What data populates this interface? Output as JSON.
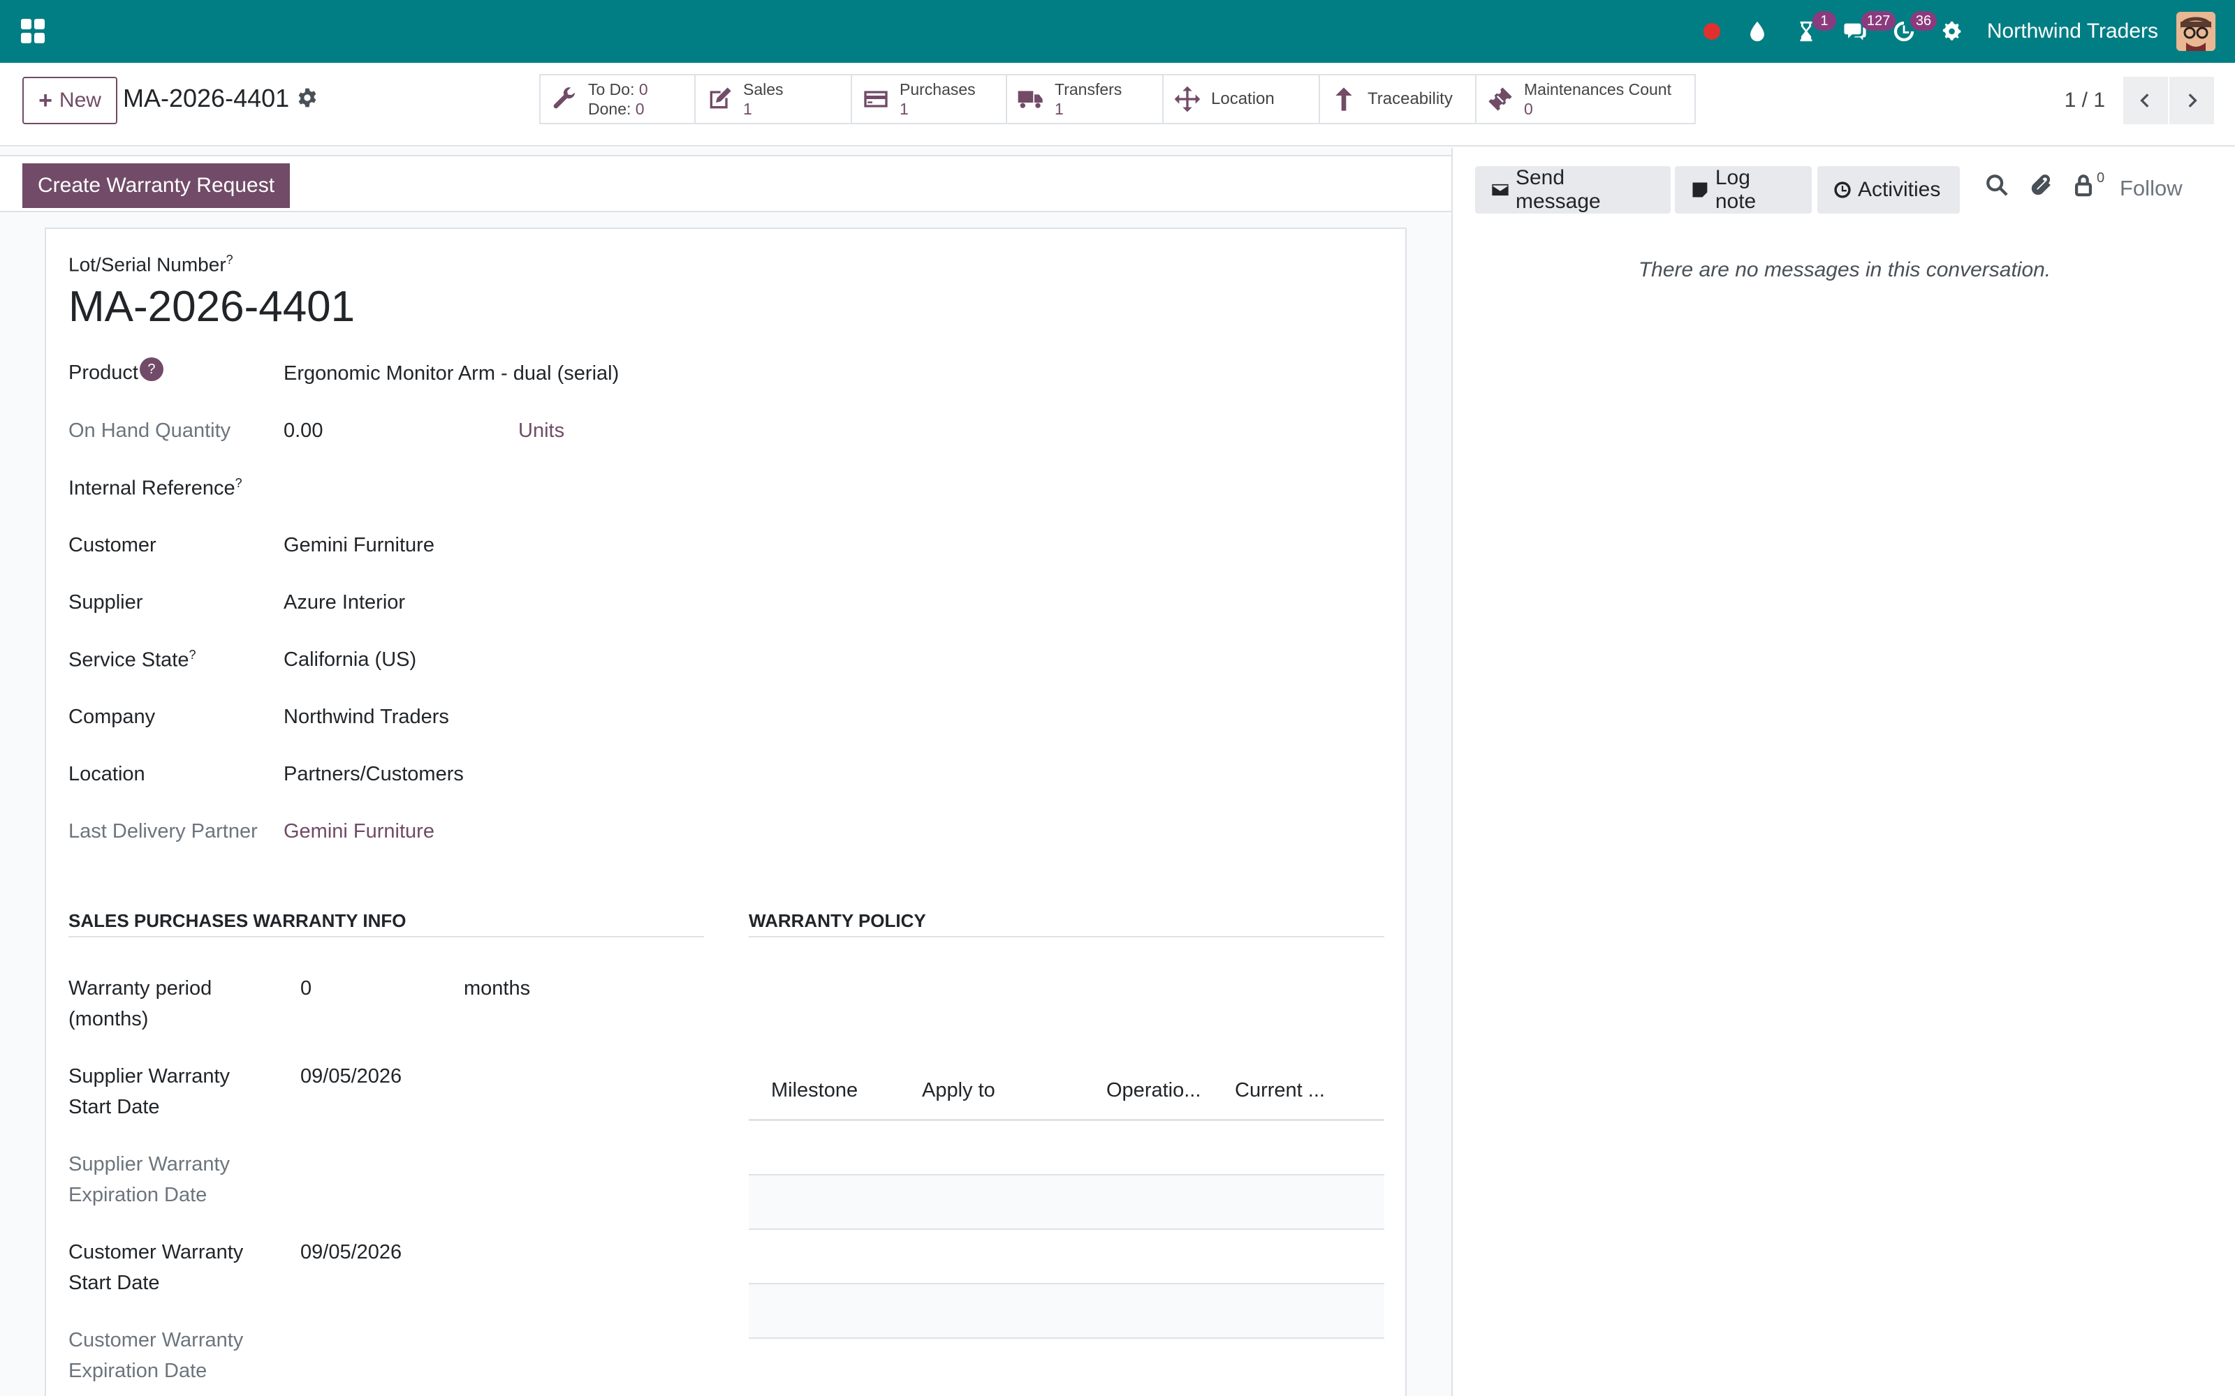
{
  "navbar": {
    "company": "Northwind Traders",
    "activity_badge": "1",
    "messages_badge": "127",
    "clock_badge": "36"
  },
  "control_panel": {
    "new_label": "New",
    "record_name": "MA-2026-4401",
    "pager_value": "1 / 1"
  },
  "smart_buttons": {
    "maintenance": {
      "todo_label": "To Do:",
      "todo_value": "0",
      "done_label": "Done:",
      "done_value": "0"
    },
    "sales": {
      "label": "Sales",
      "value": "1"
    },
    "purchases": {
      "label": "Purchases",
      "value": "1"
    },
    "transfers": {
      "label": "Transfers",
      "value": "1"
    },
    "location": {
      "label": "Location"
    },
    "traceability": {
      "label": "Traceability"
    },
    "maintenances_count": {
      "label": "Maintenances Count",
      "value": "0"
    }
  },
  "statusbar": {
    "warranty_button": "Create Warranty Request"
  },
  "form": {
    "lot_label": "Lot/Serial Number",
    "lot_value": "MA-2026-4401",
    "help_mark": "?",
    "fields": {
      "product": {
        "label": "Product",
        "value": "Ergonomic Monitor Arm - dual (serial)"
      },
      "on_hand": {
        "label": "On Hand Quantity",
        "value": "0.00",
        "unit": "Units"
      },
      "internal_ref": {
        "label": "Internal Reference",
        "value": ""
      },
      "customer": {
        "label": "Customer",
        "value": "Gemini Furniture"
      },
      "supplier": {
        "label": "Supplier",
        "value": "Azure Interior"
      },
      "service_state": {
        "label": "Service State",
        "value": "California (US)"
      },
      "company": {
        "label": "Company",
        "value": "Northwind Traders"
      },
      "location": {
        "label": "Location",
        "value": "Partners/Customers"
      },
      "last_delivery_partner": {
        "label": "Last Delivery Partner",
        "value": "Gemini Furniture"
      }
    },
    "warranty_info": {
      "title": "SALES PURCHASES WARRANTY INFO",
      "period_label_1": "Warranty period",
      "period_label_2": "(months)",
      "period_value": "0",
      "period_unit": "months",
      "sup_start_1": "Supplier Warranty",
      "sup_start_2": "Start Date",
      "sup_start_value": "09/05/2026",
      "sup_exp_1": "Supplier Warranty",
      "sup_exp_2": "Expiration Date",
      "cust_start_1": "Customer Warranty",
      "cust_start_2": "Start Date",
      "cust_start_value": "09/05/2026",
      "cust_exp_1": "Customer Warranty",
      "cust_exp_2": "Expiration Date"
    },
    "warranty_policy": {
      "title": "WARRANTY POLICY",
      "columns": [
        "Milestone",
        "Apply to",
        "Operatio...",
        "Current ..."
      ]
    }
  },
  "chatter": {
    "send_message": "Send message",
    "log_note": "Log note",
    "activities": "Activities",
    "follower_count": "0",
    "follow": "Follow",
    "empty": "There are no messages in this conversation."
  }
}
